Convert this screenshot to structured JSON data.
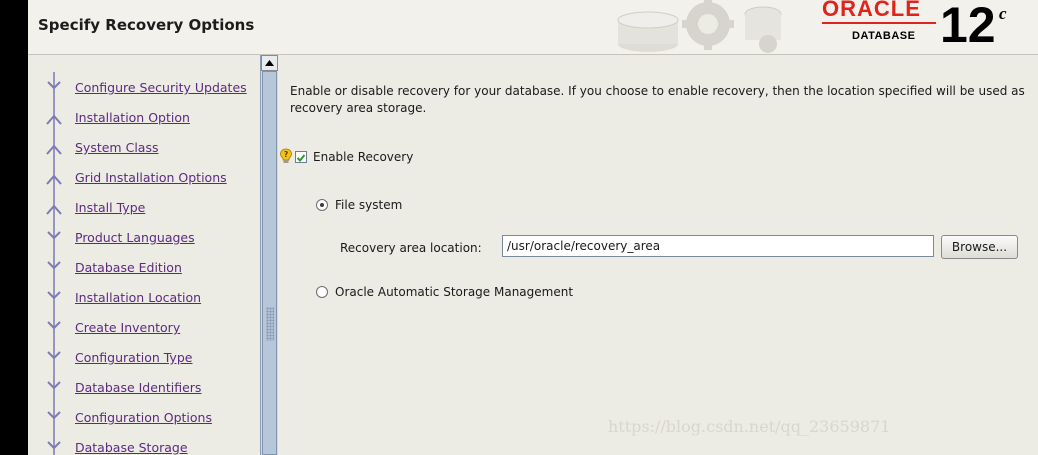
{
  "header": {
    "title": "Specify Recovery Options",
    "brand": {
      "oracle": "ORACLE",
      "database": "DATABASE",
      "version_number": "12",
      "version_suffix": "c"
    }
  },
  "nav": {
    "items": [
      {
        "label": "Configure Security Updates",
        "icon": "step-done-icon"
      },
      {
        "label": "Installation Option",
        "icon": "step-branch-icon"
      },
      {
        "label": "System Class",
        "icon": "step-branch-icon"
      },
      {
        "label": "Grid Installation Options",
        "icon": "step-branch-icon"
      },
      {
        "label": "Install Type",
        "icon": "step-branch-icon"
      },
      {
        "label": "Product Languages",
        "icon": "step-done-icon"
      },
      {
        "label": "Database Edition",
        "icon": "step-done-icon"
      },
      {
        "label": "Installation Location",
        "icon": "step-done-icon"
      },
      {
        "label": "Create Inventory",
        "icon": "step-done-icon"
      },
      {
        "label": "Configuration Type",
        "icon": "step-done-icon"
      },
      {
        "label": "Database Identifiers",
        "icon": "step-done-icon"
      },
      {
        "label": "Configuration Options",
        "icon": "step-done-icon"
      },
      {
        "label": "Database Storage",
        "icon": "step-done-icon"
      }
    ]
  },
  "main": {
    "description": "Enable or disable recovery for your database. If you choose to enable recovery, then the location specified will be used as recovery area storage.",
    "enable_recovery": {
      "label": "Enable Recovery",
      "checked": true
    },
    "file_system": {
      "label": "File system",
      "selected": true
    },
    "recovery_location": {
      "label": "Recovery area location:",
      "value": "/usr/oracle/recovery_area"
    },
    "browse_label": "Browse...",
    "asm": {
      "label": "Oracle Automatic Storage Management",
      "selected": false
    }
  },
  "watermark": "https://blog.csdn.net/qq_23659871",
  "colors": {
    "link": "#5c2a80",
    "oracle_red": "#e0231b",
    "checkbox_green": "#2e9a2e",
    "scrollbar": "#b7c7da"
  }
}
